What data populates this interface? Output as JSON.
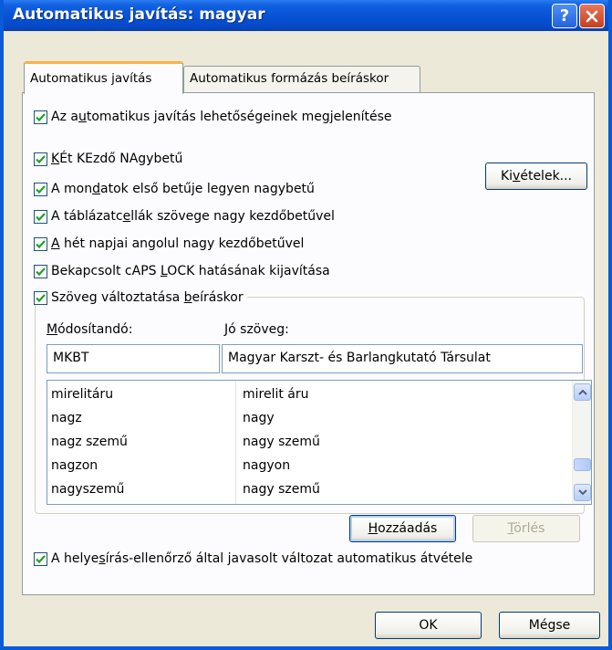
{
  "window": {
    "title": "Automatikus javítás: magyar",
    "help_label": "?",
    "colors": {
      "titlebar": "#0853d6",
      "accent": "#f7b24a",
      "check": "#21a121"
    }
  },
  "tabs": [
    {
      "label": "Automatikus javítás",
      "active": true
    },
    {
      "label": "Automatikus formázás beíráskor",
      "active": false
    }
  ],
  "options": {
    "show_buttons": {
      "pre": "Az a",
      "key": "u",
      "post": "tomatikus javítás lehetőségeinek megjelenítése",
      "checked": true
    },
    "two_initial": {
      "pre": "",
      "key": "K",
      "post": "Ét KEzdő NAgybetű",
      "checked": true
    },
    "first_letter": {
      "pre": "A mon",
      "key": "d",
      "post": "atok első betűje legyen nagybetű",
      "checked": true
    },
    "table_cells": {
      "pre": "A táblázatc",
      "key": "e",
      "post": "llák szövege nagy kezdőbetűvel",
      "checked": true
    },
    "day_names": {
      "pre": "",
      "key": "A",
      "post": " hét napjai angolul nagy kezdőbetűvel",
      "checked": true
    },
    "caps_lock": {
      "pre": "Bekapcsolt cAPS ",
      "key": "L",
      "post": "OCK hatásának kijavítása",
      "checked": true
    },
    "replace_text": {
      "pre": "Szöveg változtatása ",
      "key": "b",
      "post": "eíráskor",
      "checked": true
    },
    "spell_suggest": {
      "pre": "A helye",
      "key": "s",
      "post": "írás-ellenőrző által javasolt változat automatikus átvétele",
      "checked": true
    }
  },
  "exceptions_button": {
    "pre": "Ki",
    "key": "v",
    "post": "ételek..."
  },
  "replace": {
    "label": {
      "pre": "",
      "key": "M",
      "post": "ódosítandó:"
    },
    "value": "MKBT"
  },
  "with": {
    "label": {
      "pre": "",
      "key": "J",
      "post": "ó szöveg:"
    },
    "value": "Magyar Karszt- és Barlangkutató Társulat"
  },
  "list": [
    {
      "from": "mirelitáru",
      "to": "mirelit áru"
    },
    {
      "from": "nagz",
      "to": "nagy"
    },
    {
      "from": "nagz szemű",
      "to": "nagy szemű"
    },
    {
      "from": "nagzon",
      "to": "nagyon"
    },
    {
      "from": "nagyszemű",
      "to": "nagy szemű"
    }
  ],
  "add_button": {
    "pre": "",
    "key": "H",
    "post": "ozzáadás"
  },
  "delete_button": {
    "pre": "",
    "key": "T",
    "post": "örlés"
  },
  "ok_button": "OK",
  "cancel_button": "Mégse"
}
